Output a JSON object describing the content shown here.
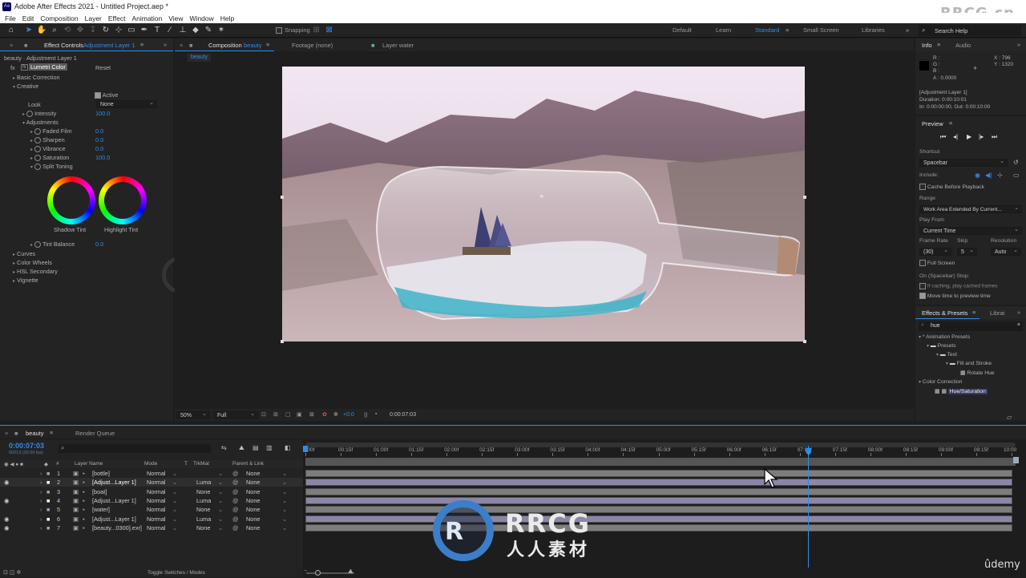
{
  "app": {
    "title": "Adobe After Effects 2021 - Untitled Project.aep *",
    "logo": "Ae",
    "watermark": "RRCG.cn",
    "menu": [
      "File",
      "Edit",
      "Composition",
      "Layer",
      "Effect",
      "Animation",
      "View",
      "Window",
      "Help"
    ]
  },
  "toolbar": {
    "snapping_label": "Snapping",
    "workspaces": [
      "Default",
      "Learn",
      "Standard",
      "Small Screen",
      "Libraries"
    ],
    "active_workspace": "Standard",
    "search_placeholder": "Search Help"
  },
  "effect_controls": {
    "tab_label": "Effect Controls",
    "tab_target": "Adjustment Layer 1",
    "header": "beauty · Adjustment Layer 1",
    "effect_name": "Lumetri Color",
    "reset": "Reset",
    "sections": {
      "basic": "Basic Correction",
      "creative": "Creative",
      "curves": "Curves",
      "wheels": "Color Wheels",
      "hsl": "HSL Secondary",
      "vignette": "Vignette"
    },
    "active_label": "Active",
    "look_label": "Look",
    "look_value": "None",
    "intensity_label": "Intensity",
    "intensity_value": "100.0",
    "adjustments_label": "Adjustments",
    "faded_film_label": "Faded Film",
    "faded_film_value": "0.0",
    "sharpen_label": "Sharpen",
    "sharpen_value": "0.0",
    "vibrance_label": "Vibrance",
    "vibrance_value": "0.0",
    "saturation_label": "Saturation",
    "saturation_value": "100.0",
    "split_toning_label": "Split Toning",
    "shadow_tint_label": "Shadow Tint",
    "highlight_tint_label": "Highlight Tint",
    "tint_balance_label": "Tint Balance",
    "tint_balance_value": "0.0"
  },
  "composition": {
    "tab_label": "Composition",
    "tab_target": "beauty",
    "footage_tab": "Footage (none)",
    "layer_tab": "Layer water",
    "breadcrumb": "beauty",
    "zoom": "50%",
    "resolution": "Full",
    "exposure": "+0.0",
    "timecode": "0:00:07:03"
  },
  "info": {
    "tab_label": "Info",
    "audio_tab": "Audio",
    "r_label": "R :",
    "g_label": "G :",
    "b_label": "B :",
    "a_label": "A : 0.0000",
    "x_label": "X : 796",
    "y_label": "Y : 1320",
    "layer_name": "[Adjustment Layer 1]",
    "duration": "Duration: 0:00:10:01",
    "in_out": "In: 0:00:00:00, Out: 0:00:10:00"
  },
  "preview": {
    "title": "Preview",
    "shortcut_label": "Shortcut",
    "shortcut_value": "Spacebar",
    "include_label": "Include:",
    "cache_label": "Cache Before Playback",
    "range_label": "Range",
    "range_value": "Work Area Extended By Current...",
    "play_from_label": "Play From",
    "play_from_value": "Current Time",
    "frame_rate_label": "Frame Rate",
    "frame_rate_value": "(30)",
    "skip_label": "Skip",
    "skip_value": "5",
    "resolution_label": "Resolution",
    "resolution_value": "Auto",
    "full_screen_label": "Full Screen",
    "on_stop_label": "On (Spacebar) Stop:",
    "if_caching_label": "If caching, play cached frames",
    "move_time_label": "Move time to preview time"
  },
  "effects_presets": {
    "tab_label": "Effects & Presets",
    "libraries_tab": "Librai",
    "search_value": "hue",
    "tree": [
      {
        "label": "* Animation Presets",
        "indent": 0
      },
      {
        "label": "Presets",
        "indent": 1
      },
      {
        "label": "Text",
        "indent": 2
      },
      {
        "label": "Fill and Stroke",
        "indent": 3
      },
      {
        "label": "Rotate Hue",
        "indent": 4
      },
      {
        "label": "Color Correction",
        "indent": 0
      },
      {
        "label": "Hue/Saturation",
        "indent": 1
      }
    ]
  },
  "timeline": {
    "tab_label": "beauty",
    "render_queue": "Render Queue",
    "current_time": "0:00:07:03",
    "frame_info": "00213 (30.00 fps)",
    "columns": {
      "num": "#",
      "layer_name": "Layer Name",
      "mode": "Mode",
      "t": "T",
      "trkmat": "TrkMat",
      "parent": "Parent & Link"
    },
    "ruler": [
      "0:00f",
      "00:15f",
      "01:00f",
      "01:15f",
      "02:00f",
      "02:15f",
      "03:00f",
      "03:15f",
      "04:00f",
      "04:15f",
      "05:00f",
      "05:15f",
      "06:00f",
      "06:15f",
      "07:00f",
      "07:15f",
      "08:00f",
      "08:15f",
      "09:00f",
      "09:15f",
      "10:00"
    ],
    "layers": [
      {
        "num": "1",
        "name": "[bottle]",
        "mode": "Normal",
        "trkmat": "",
        "parent": "None",
        "visible": false,
        "color": "#9fa0bf"
      },
      {
        "num": "2",
        "name": "[Adjust...Layer 1]",
        "mode": "Normal",
        "trkmat": "Luma",
        "parent": "None",
        "visible": true,
        "color": "#ffffff"
      },
      {
        "num": "3",
        "name": "[boat]",
        "mode": "Normal",
        "trkmat": "None",
        "parent": "None",
        "visible": false,
        "color": "#9fa0bf"
      },
      {
        "num": "4",
        "name": "[Adjust...Layer 1]",
        "mode": "Normal",
        "trkmat": "Luma",
        "parent": "None",
        "visible": true,
        "color": "#ffffff"
      },
      {
        "num": "5",
        "name": "[water]",
        "mode": "Normal",
        "trkmat": "None",
        "parent": "None",
        "visible": false,
        "color": "#9fa0bf"
      },
      {
        "num": "6",
        "name": "[Adjust...Layer 1]",
        "mode": "Normal",
        "trkmat": "Luma",
        "parent": "None",
        "visible": true,
        "color": "#ffffff"
      },
      {
        "num": "7",
        "name": "[beauty...0300].exr]",
        "mode": "Normal",
        "trkmat": "None",
        "parent": "None",
        "visible": true,
        "color": "#9fa0bf"
      }
    ],
    "toggle_label": "Toggle Switches / Modes",
    "playhead_position": 0.712
  },
  "overlays": {
    "center_logo": "RRCG",
    "center_sub": "人人素材",
    "udemy": "ûdemy"
  },
  "colors": {
    "accent": "#2d8ceb",
    "panel": "#232323",
    "background": "#1d1d1d"
  }
}
